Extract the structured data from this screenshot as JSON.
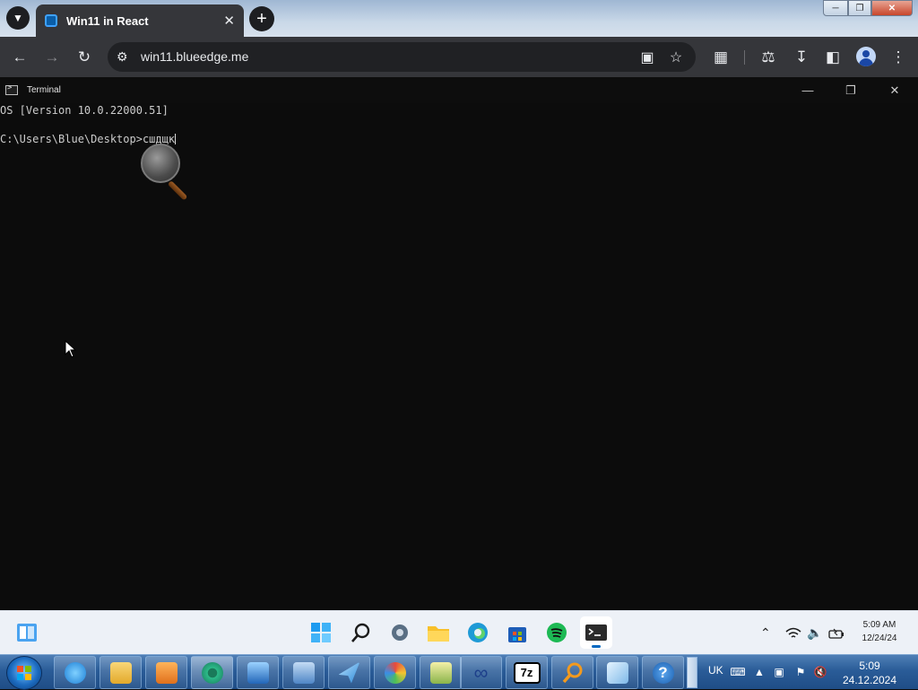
{
  "browser": {
    "tab": {
      "title": "Win11 in React",
      "close_icon": "close-icon"
    },
    "url": "win11.blueedge.me",
    "colors": {
      "tab_active": "#35363a",
      "omnibox": "#202124",
      "tabstrip": "#c9d8e8"
    }
  },
  "terminal": {
    "title": "Terminal",
    "lines": [
      "OS [Version 10.0.22000.51]",
      "C:\\Users\\Blue\\Desktop>сшдщк"
    ],
    "colors": {
      "background": "#0c0c0c",
      "text": "#cccccc"
    }
  },
  "win11_taskbar": {
    "apps": [
      "widgets",
      "start",
      "search",
      "settings",
      "file-explorer",
      "edge",
      "store",
      "spotify",
      "terminal"
    ],
    "active_app": "terminal",
    "clock": {
      "time": "5:09 AM",
      "date": "12/24/24"
    }
  },
  "win7_taskbar": {
    "language": "UK",
    "clock": {
      "time": "5:09",
      "date": "24.12.2024"
    },
    "pinned": [
      "internet-explorer",
      "windows-explorer",
      "media-player",
      "chrome-like",
      "remote-desktop",
      "network",
      "messenger",
      "paint",
      "notepad",
      "infinity",
      "7zip",
      "search",
      "notes",
      "help"
    ]
  }
}
